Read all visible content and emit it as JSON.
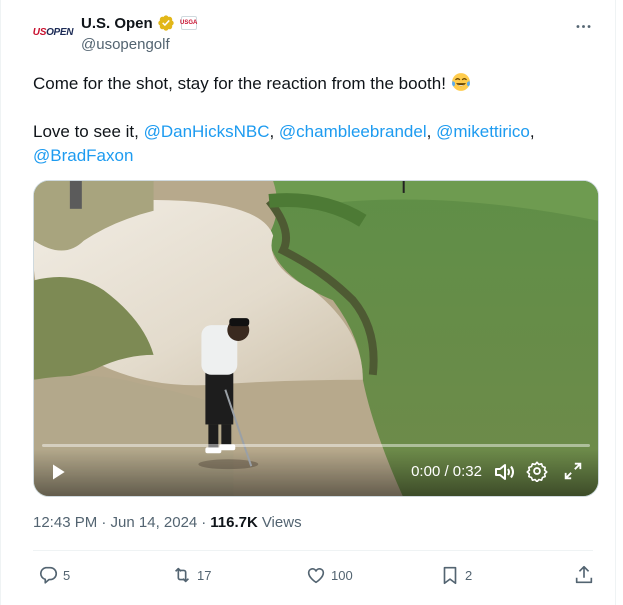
{
  "author": {
    "display_name": "U.S. Open",
    "handle": "@usopengolf",
    "avatar_text_us": "US",
    "avatar_text_open": "OPEN",
    "affiliate_badge": "USGA"
  },
  "tweet": {
    "line1_text": "Come for the shot, stay for the reaction from the booth! ",
    "line1_emoji": "face-with-tears-of-joy",
    "line2_prefix": "Love to see it, ",
    "mentions": [
      "@DanHicksNBC",
      "@chambleebrandel",
      "@mikettirico",
      "@BradFaxon"
    ],
    "separator": ", "
  },
  "video": {
    "time_display": "0:00 / 0:32",
    "progress": 0
  },
  "meta": {
    "timestamp": "12:43 PM · Jun 14, 2024",
    "dot": "·",
    "views_count": "116.7K",
    "views_label": "Views"
  },
  "actions": {
    "replies": "5",
    "reposts": "17",
    "likes": "100",
    "bookmarks": "2"
  },
  "colors": {
    "accent": "#1d9bf0",
    "verified_gold": "#e2b719",
    "secondary_text": "#536471"
  }
}
